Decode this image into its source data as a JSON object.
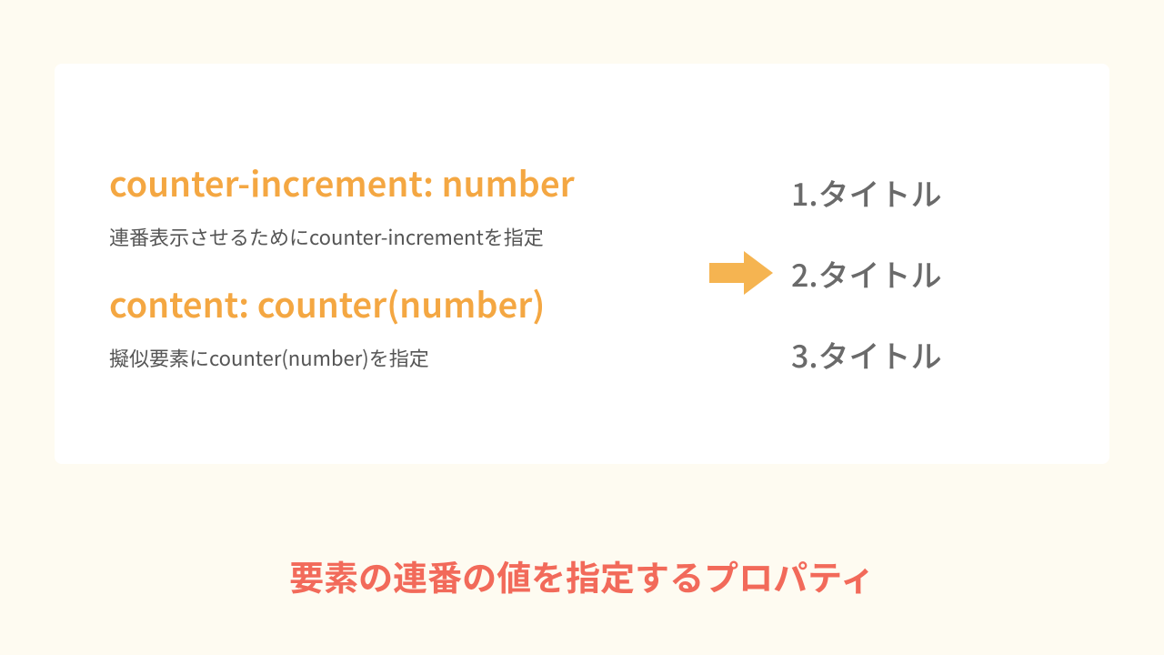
{
  "card": {
    "block1": {
      "heading": "counter-increment: number",
      "desc": "連番表示させるためにcounter-incrementを指定"
    },
    "block2": {
      "heading": "content: counter(number)",
      "desc": "擬似要素にcounter(number)を指定"
    },
    "list": [
      "1.タイトル",
      "2.タイトル",
      "3.タイトル"
    ]
  },
  "footer": "要素の連番の値を指定するプロパティ",
  "colors": {
    "orange": "#f4a742",
    "coral": "#f26a5a"
  }
}
